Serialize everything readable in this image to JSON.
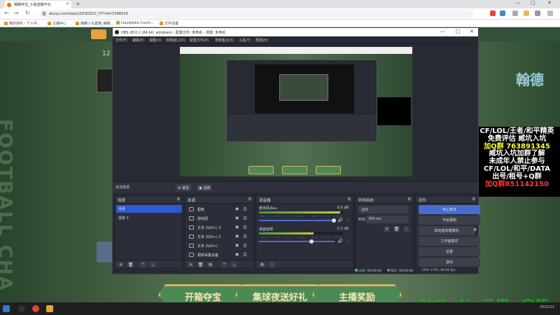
{
  "browser": {
    "tab_title": "蝴蝶存宝_斗鱼直播平台",
    "url": "douyu.com/topic/LYCB2022_CF?rid=5396028",
    "bookmarks": [
      "我的资料 - 个人中...",
      "主播中心",
      "蝴蝶小鸟直播_蝴蝶...",
      "Liquipedia Count...",
      "文件设置"
    ]
  },
  "page": {
    "left_number": "12",
    "side_text": "FOOTBALL CHA",
    "right_art": "翰德",
    "ad_lines": [
      "CF/LOL/王者/和平精英",
      "免费评估 威坑入坑",
      "加Q群 763891345",
      "威坑入坑加群了解",
      "未成年人禁止参与",
      "CF/LOL/和平/DATA",
      "出号/租号+Q群",
      "加Q群851142150"
    ],
    "buttons": [
      "开箱夺宝",
      "集球夜送好礼",
      "主播奖励"
    ],
    "watermark": "钻粉+V+马甲+房管"
  },
  "obs": {
    "title": "OBS 28.0.1 (64-bit, windows) - 配置文件: 未命名 - 场景: 未命名",
    "menu": [
      "文件(F)",
      "编辑(E)",
      "视图(V)",
      "停靠窗口(D)",
      "配置文件(P)",
      "场景集合(S)",
      "工具(T)",
      "帮助(H)"
    ],
    "no_source": "未选择源",
    "strip_buttons": [
      "属性",
      "滤镜"
    ],
    "scenes": {
      "title": "场景",
      "items": [
        "场景",
        "场景 2"
      ],
      "selected": 0
    },
    "sources": {
      "title": "来源",
      "items": [
        "图像",
        "游戏源",
        "文本 (GDI+) 3",
        "文本 (GDI+) 2",
        "文本 (GDI+)",
        "视频采集设备"
      ]
    },
    "mixer": {
      "title": "混音器",
      "channels": [
        {
          "name": "麦克风/Aux",
          "db": "0.0 dB",
          "level": 0.97
        },
        {
          "name": "桌面音频",
          "db": "-7.2 dB",
          "level": 0.65
        }
      ],
      "scale": "-60 -55 -50 -45 -40 -35 -30 -25 -20 -15 -10 -5 0"
    },
    "transitions": {
      "title": "转场特效",
      "type": "淡出",
      "duration_label": "时长",
      "duration": "300 ms"
    },
    "controls": {
      "title": "控件",
      "buttons": [
        "停止推流",
        "开始录制",
        "启动虚拟摄像机",
        "工作室模式",
        "设置",
        "退出"
      ]
    },
    "status": {
      "live": "LIVE: 00:00:00",
      "rec": "REC: 00:00:00",
      "cpu": "CPU: 0.5%, 60.00 fps"
    }
  },
  "taskbar": {
    "clock": "2022/11"
  },
  "colors": {
    "accent": "#476bd0",
    "scene_sel": "#2c5bd6",
    "ad_red": "#ff3333",
    "wm": "#00cc00"
  }
}
